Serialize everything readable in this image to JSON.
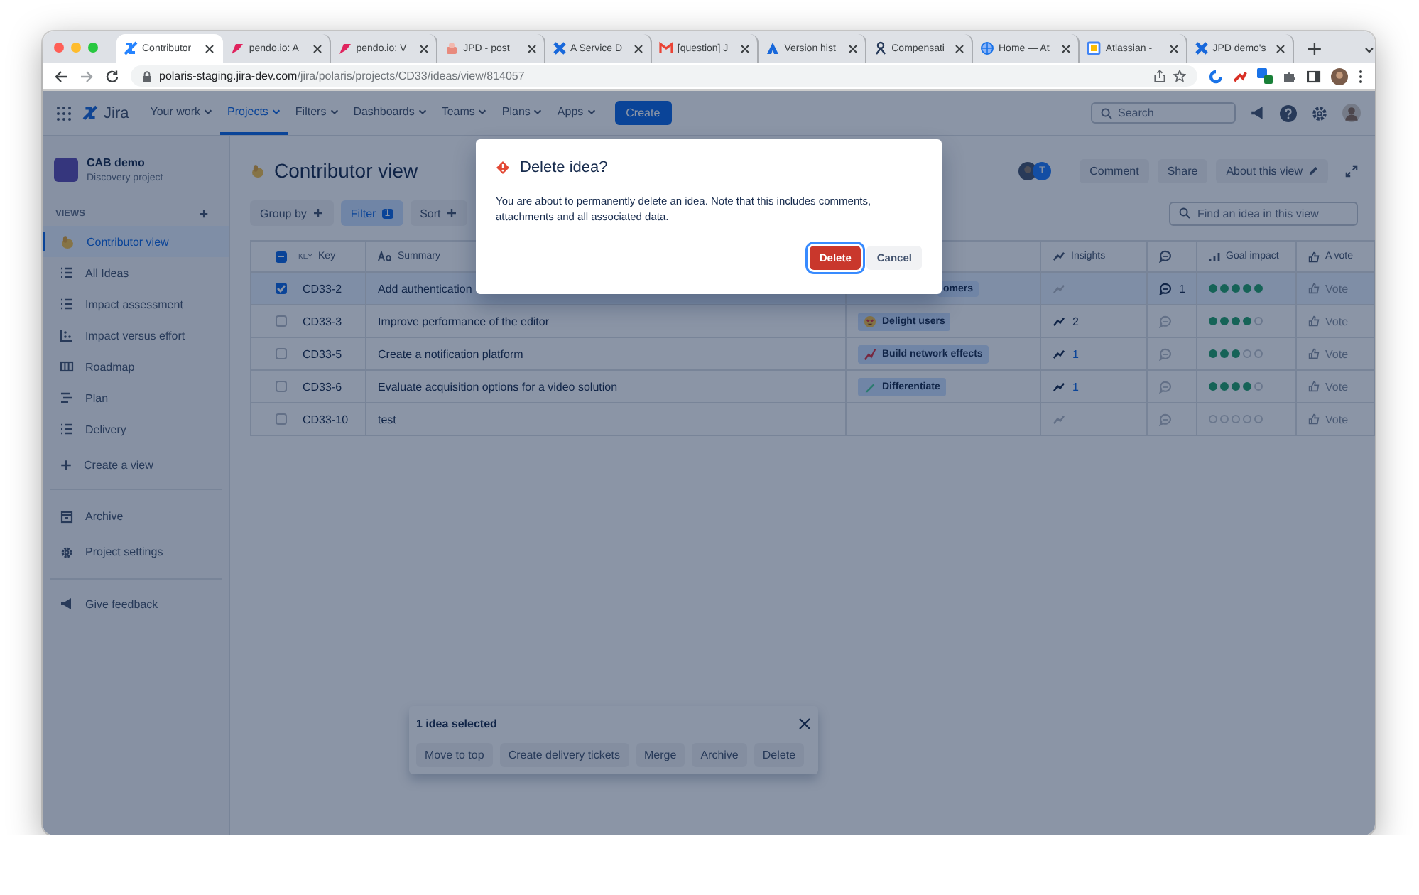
{
  "browser": {
    "tabs": [
      {
        "title": "Contributor",
        "selected": true,
        "kind": "jpd"
      },
      {
        "title": "pendo.io: A",
        "selected": false,
        "kind": "pendo"
      },
      {
        "title": "pendo.io: V",
        "selected": false,
        "kind": "pendo"
      },
      {
        "title": "JPD - post",
        "selected": false,
        "kind": "cake"
      },
      {
        "title": "A Service D",
        "selected": false,
        "kind": "confluence"
      },
      {
        "title": "[question] J",
        "selected": false,
        "kind": "mail"
      },
      {
        "title": "Version hist",
        "selected": false,
        "kind": "atlassian"
      },
      {
        "title": "Compensati",
        "selected": false,
        "kind": "person"
      },
      {
        "title": "Home — At",
        "selected": false,
        "kind": "globe"
      },
      {
        "title": "Atlassian -",
        "selected": false,
        "kind": "calendar"
      },
      {
        "title": "JPD demo's",
        "selected": false,
        "kind": "confluence"
      }
    ],
    "url": {
      "host": "polaris-staging.jira-dev.com",
      "path": "/jira/polaris/projects/CD33/ideas/view/814057"
    }
  },
  "top_nav": {
    "product": "Jira",
    "items": [
      {
        "label": "Your work",
        "selected": false
      },
      {
        "label": "Projects",
        "selected": true
      },
      {
        "label": "Filters",
        "selected": false
      },
      {
        "label": "Dashboards",
        "selected": false
      },
      {
        "label": "Teams",
        "selected": false
      },
      {
        "label": "Plans",
        "selected": false
      },
      {
        "label": "Apps",
        "selected": false
      }
    ],
    "create_button": "Create",
    "search": {
      "placeholder": "Search"
    }
  },
  "sidebar": {
    "project_name": "CAB demo",
    "project_type": "Discovery project",
    "section_title": "VIEWS",
    "items": [
      {
        "label": "Contributor view",
        "selected": true,
        "kind": "view"
      },
      {
        "label": "All Ideas",
        "selected": false,
        "kind": "list"
      },
      {
        "label": "Impact assessment",
        "selected": false,
        "kind": "list"
      },
      {
        "label": "Impact versus effort",
        "selected": false,
        "kind": "chart"
      },
      {
        "label": "Roadmap",
        "selected": false,
        "kind": "board"
      },
      {
        "label": "Plan",
        "selected": false,
        "kind": "plan"
      },
      {
        "label": "Delivery",
        "selected": false,
        "kind": "list"
      }
    ],
    "create_view": "Create a view",
    "footer_items": [
      {
        "label": "Archive",
        "kind": "archive"
      },
      {
        "label": "Project settings",
        "kind": "settings"
      }
    ],
    "feedback": "Give feedback"
  },
  "view": {
    "title": "Contributor view",
    "avatar_letter": "T",
    "actions": [
      "Comment",
      "Share",
      "About this view"
    ],
    "toolbar": [
      {
        "label": "Group by",
        "kind": "add"
      },
      {
        "label": "Filter",
        "kind": "count",
        "count": "1"
      },
      {
        "label": "Sort",
        "kind": "add"
      }
    ],
    "find": {
      "placeholder": "Find an idea in this view"
    },
    "table": {
      "columns": [
        {
          "label": "Key",
          "tag": "KEY",
          "kind": "key",
          "indeterminate": true
        },
        {
          "label": "Summary",
          "kind": "summary"
        },
        {
          "label": "Insights",
          "kind": "insights"
        },
        {
          "kind": "comments"
        },
        {
          "label": "Goal impact",
          "kind": "impact"
        },
        {
          "label": "A vote",
          "kind": "vote"
        }
      ],
      "rows": [
        {
          "key": "CD33-2",
          "summary": "Add authentication",
          "checked": true,
          "goal": {
            "label": "omers"
          },
          "comments": "1",
          "stars": 5,
          "vote": "Vote"
        },
        {
          "key": "CD33-3",
          "summary": "Improve performance of the editor",
          "checked": false,
          "goal": {
            "label": "Delight users",
            "kind": "smile"
          },
          "insights": {
            "count": "2",
            "linked": false
          },
          "stars": 4,
          "vote": "Vote"
        },
        {
          "key": "CD33-5",
          "summary": "Create a notification platform",
          "checked": false,
          "goal": {
            "label": "Build network effects",
            "kind": "trend"
          },
          "insights": {
            "count": "1",
            "linked": true
          },
          "stars": 3,
          "vote": "Vote"
        },
        {
          "key": "CD33-6",
          "summary": "Evaluate acquisition options for a video solution",
          "checked": false,
          "goal": {
            "label": "Differentiate",
            "kind": "pencil"
          },
          "insights": {
            "count": "1",
            "linked": true
          },
          "stars": 4,
          "vote": "Vote"
        },
        {
          "key": "CD33-10",
          "summary": "test",
          "checked": false,
          "stars": 0,
          "vote": "Vote"
        }
      ]
    }
  },
  "selection_bar": {
    "title": "1 idea selected",
    "actions": [
      "Move to top",
      "Create delivery tickets",
      "Merge",
      "Archive",
      "Delete"
    ]
  },
  "dialog": {
    "title": "Delete idea?",
    "body": "You are about to permanently delete an idea. Note that this includes comments, attachments and all associated data.",
    "buttons": [
      {
        "label": "Delete",
        "kind": "danger",
        "focused": true
      },
      {
        "label": "Cancel",
        "kind": "subtle",
        "focused": false
      }
    ]
  }
}
